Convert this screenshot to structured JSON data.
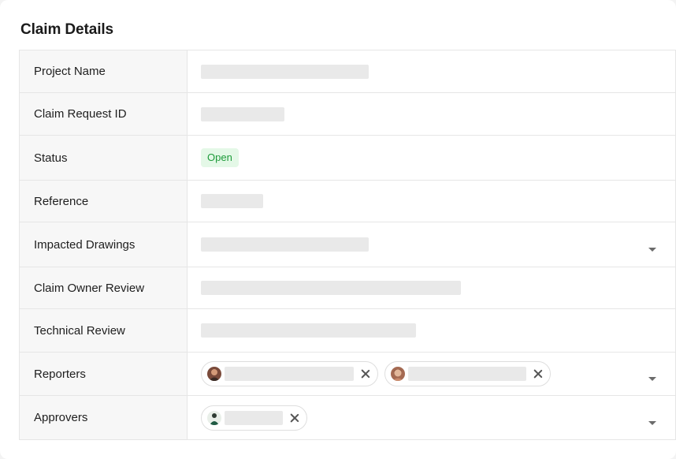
{
  "card": {
    "title": "Claim Details"
  },
  "rows": {
    "project_name": {
      "label": "Project Name"
    },
    "claim_request_id": {
      "label": "Claim Request ID"
    },
    "status": {
      "label": "Status",
      "value": "Open"
    },
    "reference": {
      "label": "Reference"
    },
    "impacted_drawings": {
      "label": "Impacted Drawings",
      "dropdown_icon": "chevron-down-icon"
    },
    "claim_owner_review": {
      "label": "Claim Owner Review"
    },
    "technical_review": {
      "label": "Technical Review"
    },
    "reporters": {
      "label": "Reporters",
      "chip_count": 2,
      "dropdown_icon": "chevron-down-icon"
    },
    "approvers": {
      "label": "Approvers",
      "chip_count": 1,
      "dropdown_icon": "chevron-down-icon"
    }
  },
  "colors": {
    "status_open_bg": "#e4f8e7",
    "status_open_text": "#1e9b3a",
    "label_column_bg": "#f7f7f7",
    "placeholder": "#e9e9e9"
  }
}
